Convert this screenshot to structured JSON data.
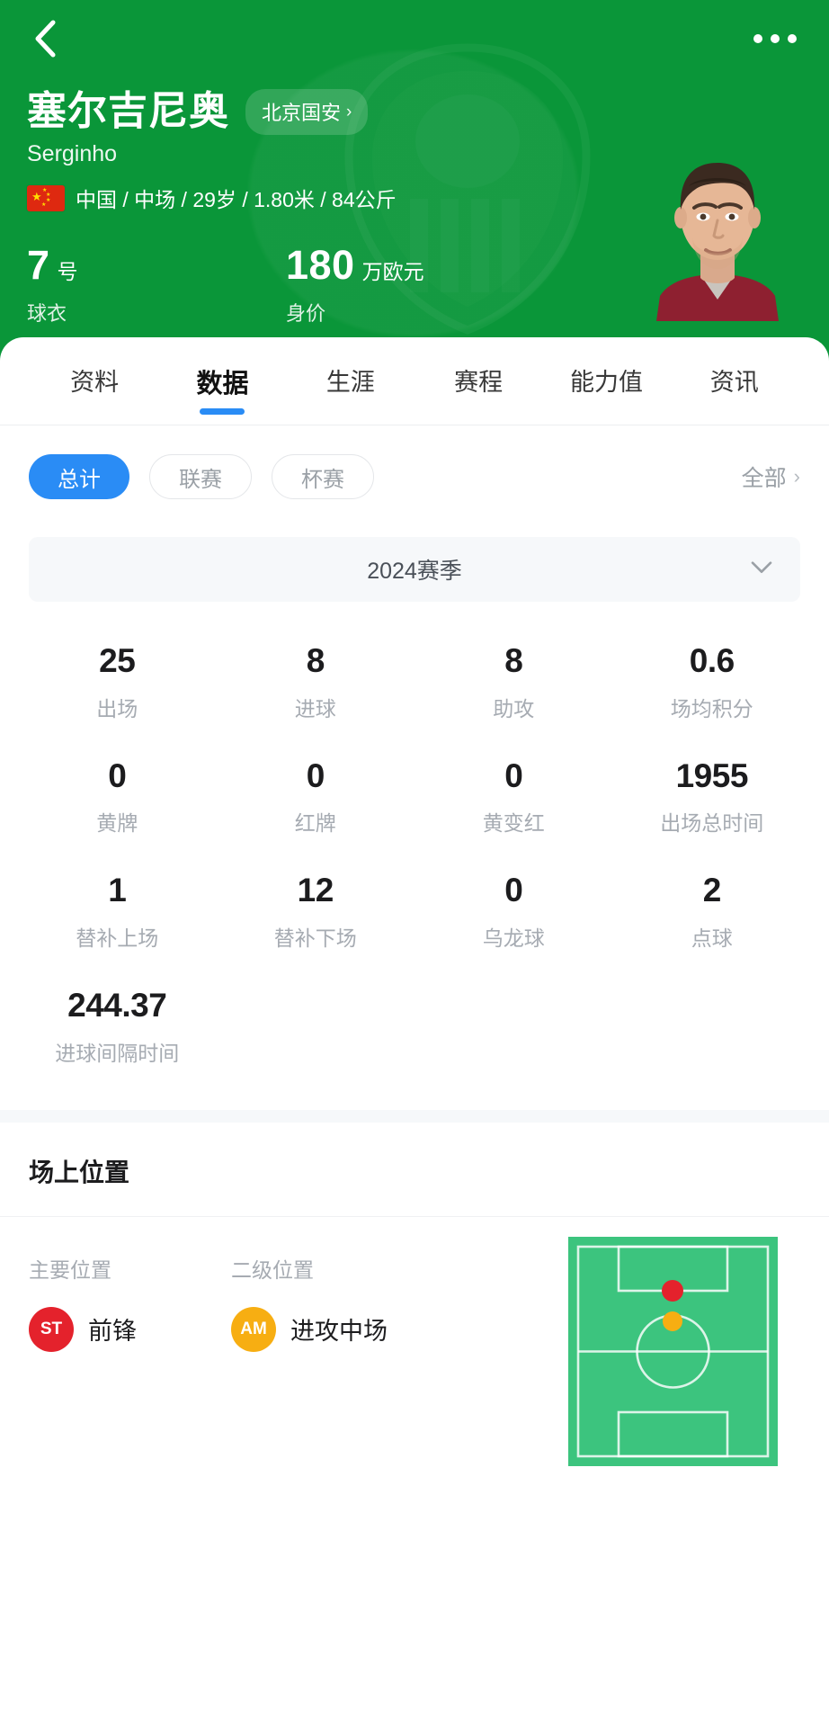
{
  "nav": {
    "back_icon": "chevron-left-icon",
    "more_icon": "more-horizontal-icon"
  },
  "player": {
    "name_cn": "塞尔吉尼奥",
    "name_latin": "Serginho",
    "team": "北京国安",
    "team_chevron": "›",
    "nationality": "中国",
    "meta_line": "中国 / 中场 / 29岁 / 1.80米 / 84公斤",
    "position_role": "中场",
    "age": "29岁",
    "height": "1.80米",
    "weight": "84公斤",
    "shirt_number": "7",
    "shirt_unit": "号",
    "shirt_label": "球衣",
    "market_value": "180",
    "market_unit": "万欧元",
    "market_label": "身价"
  },
  "tabs": [
    {
      "label": "资料",
      "active": false
    },
    {
      "label": "数据",
      "active": true
    },
    {
      "label": "生涯",
      "active": false
    },
    {
      "label": "赛程",
      "active": false
    },
    {
      "label": "能力值",
      "active": false
    },
    {
      "label": "资讯",
      "active": false
    }
  ],
  "filters": {
    "pills": [
      {
        "label": "总计",
        "selected": true
      },
      {
        "label": "联赛",
        "selected": false
      },
      {
        "label": "杯赛",
        "selected": false
      }
    ],
    "all_label": "全部",
    "all_chevron": "›"
  },
  "season": {
    "label": "2024赛季",
    "chevron": "⌄"
  },
  "stats": [
    {
      "value": "25",
      "label": "出场"
    },
    {
      "value": "8",
      "label": "进球"
    },
    {
      "value": "8",
      "label": "助攻"
    },
    {
      "value": "0.6",
      "label": "场均积分"
    },
    {
      "value": "0",
      "label": "黄牌"
    },
    {
      "value": "0",
      "label": "红牌"
    },
    {
      "value": "0",
      "label": "黄变红"
    },
    {
      "value": "1955",
      "label": "出场总时间"
    },
    {
      "value": "1",
      "label": "替补上场"
    },
    {
      "value": "12",
      "label": "替补下场"
    },
    {
      "value": "0",
      "label": "乌龙球"
    },
    {
      "value": "2",
      "label": "点球"
    },
    {
      "value": "244.37",
      "label": "进球间隔时间"
    }
  ],
  "positions": {
    "section_title": "场上位置",
    "primary": {
      "caption": "主要位置",
      "code": "ST",
      "name": "前锋",
      "color": "#e4222c"
    },
    "secondary": {
      "caption": "二级位置",
      "code": "AM",
      "name": "进攻中场",
      "color": "#f7ae12"
    },
    "pitch": {
      "field_color": "#3cc47e",
      "line_color": "#ffffff"
    }
  },
  "colors": {
    "brand_green": "#0a9639",
    "accent_blue": "#2a8cf5",
    "pitch_green": "#3cc47e"
  }
}
